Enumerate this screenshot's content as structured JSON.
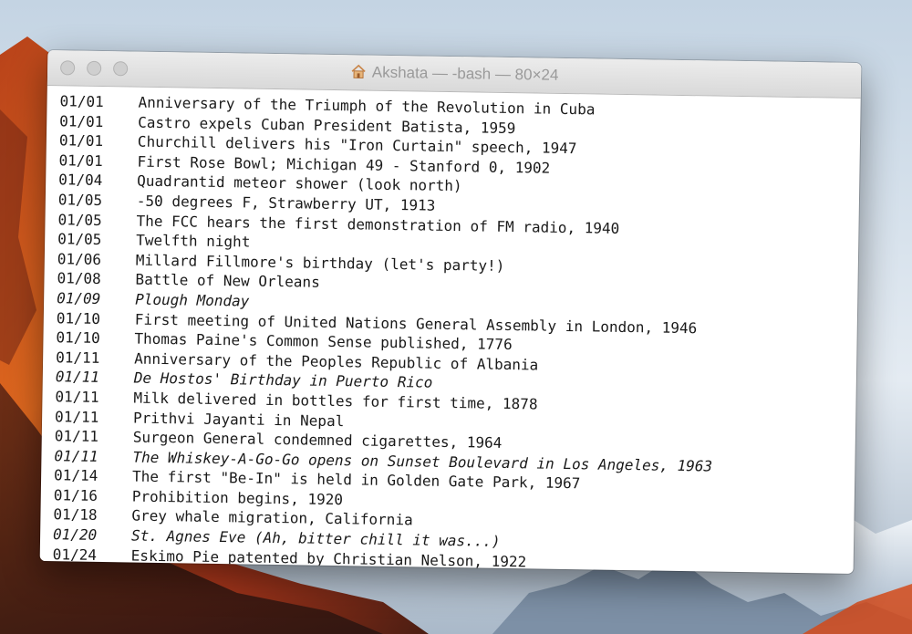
{
  "window": {
    "title": "Akshata — -bash — 80×24",
    "icon": "home-icon"
  },
  "wallpaper": {
    "description_colors": {
      "sky": "#d6e2ec",
      "cliff_orange": "#d8541c",
      "cliff_dark": "#6b2410",
      "mountain": "#e9eef3"
    }
  },
  "lines": [
    {
      "date": "01/01",
      "text": "Anniversary of the Triumph of the Revolution in Cuba",
      "italic": false
    },
    {
      "date": "01/01",
      "text": "Castro expels Cuban President Batista, 1959",
      "italic": false
    },
    {
      "date": "01/01",
      "text": "Churchill delivers his \"Iron Curtain\" speech, 1947",
      "italic": false
    },
    {
      "date": "01/01",
      "text": "First Rose Bowl; Michigan 49 - Stanford 0, 1902",
      "italic": false
    },
    {
      "date": "01/04",
      "text": "Quadrantid meteor shower (look north)",
      "italic": false
    },
    {
      "date": "01/05",
      "text": "-50 degrees F, Strawberry UT, 1913",
      "italic": false
    },
    {
      "date": "01/05",
      "text": "The FCC hears the first demonstration of FM radio, 1940",
      "italic": false
    },
    {
      "date": "01/05",
      "text": "Twelfth night",
      "italic": false
    },
    {
      "date": "01/06",
      "text": "Millard Fillmore's birthday (let's party!)",
      "italic": false
    },
    {
      "date": "01/08",
      "text": "Battle of New Orleans",
      "italic": false
    },
    {
      "date": "01/09",
      "text": "Plough Monday",
      "italic": true
    },
    {
      "date": "01/10",
      "text": "First meeting of United Nations General Assembly in London, 1946",
      "italic": false
    },
    {
      "date": "01/10",
      "text": "Thomas Paine's Common Sense published, 1776",
      "italic": false
    },
    {
      "date": "01/11",
      "text": "Anniversary of the Peoples Republic of Albania",
      "italic": false
    },
    {
      "date": "01/11",
      "text": "De Hostos' Birthday in Puerto Rico",
      "italic": true
    },
    {
      "date": "01/11",
      "text": "Milk delivered in bottles for first time, 1878",
      "italic": false
    },
    {
      "date": "01/11",
      "text": "Prithvi Jayanti in Nepal",
      "italic": false
    },
    {
      "date": "01/11",
      "text": "Surgeon General condemned cigarettes, 1964",
      "italic": false
    },
    {
      "date": "01/11",
      "text": "The Whiskey-A-Go-Go opens on Sunset Boulevard in Los Angeles, 1963",
      "italic": true
    },
    {
      "date": "01/14",
      "text": "The first \"Be-In\" is held in Golden Gate Park, 1967",
      "italic": false
    },
    {
      "date": "01/16",
      "text": "Prohibition begins, 1920",
      "italic": false
    },
    {
      "date": "01/18",
      "text": "Grey whale migration, California",
      "italic": false
    },
    {
      "date": "01/20",
      "text": "St. Agnes Eve (Ah, bitter chill it was...)",
      "italic": true
    },
    {
      "date": "01/24",
      "text": "Eskimo Pie patented by Christian Nelson, 1922",
      "italic": false
    }
  ]
}
